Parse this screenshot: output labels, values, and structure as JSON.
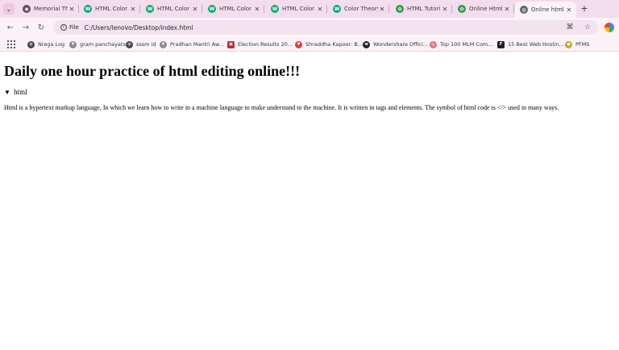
{
  "tabs": [
    {
      "title": "Memorial The",
      "icon": "memorial-favicon",
      "color": "#5b4f58"
    },
    {
      "title": "HTML Color",
      "icon": "w3schools-favicon",
      "color": "#04aa6d"
    },
    {
      "title": "HTML Color",
      "icon": "w3schools-favicon",
      "color": "#04aa6d"
    },
    {
      "title": "HTML Color",
      "icon": "w3schools-favicon",
      "color": "#04aa6d"
    },
    {
      "title": "HTML Color",
      "icon": "w3schools-favicon",
      "color": "#04aa6d"
    },
    {
      "title": "Color Theory",
      "icon": "w3schools-favicon",
      "color": "#04aa6d"
    },
    {
      "title": "HTML Tutori",
      "icon": "green-leaf-favicon",
      "color": "#2e9e4f"
    },
    {
      "title": "Online Html",
      "icon": "green-leaf-favicon",
      "color": "#2e9e4f"
    },
    {
      "title": "Online html",
      "icon": "globe-favicon",
      "color": "#5f6368"
    }
  ],
  "toolbar": {
    "back_icon": "←",
    "forward_icon": "→",
    "reload_icon": "↻",
    "chip_label": "File",
    "url": "C:/Users/lenovo/Desktop/index.html",
    "translate_icon": "⌘",
    "star_icon": "☆"
  },
  "bookmarks": [
    {
      "label": "Nrega Log",
      "icon": "globe-icon",
      "color": "#444444"
    },
    {
      "label": "gram panchayats",
      "icon": "emblem-icon",
      "color": "#8a8a8a"
    },
    {
      "label": "sssm id",
      "icon": "globe-icon",
      "color": "#444444"
    },
    {
      "label": "Pradhan Mantri Aw...",
      "icon": "emblem-icon",
      "color": "#8a8a8a"
    },
    {
      "label": "Election Results 20...",
      "icon": "election-icon",
      "color": "#c62828"
    },
    {
      "label": "Shraddha Kapoor: B...",
      "icon": "vivaldi-icon",
      "color": "#e53935"
    },
    {
      "label": "Wondershare Offici...",
      "icon": "wondershare-icon",
      "color": "#222222"
    },
    {
      "label": "Top 100 MLM Com...",
      "icon": "mlm-icon",
      "color": "#e57373"
    },
    {
      "label": "15 Best Web Hostin...",
      "icon": "f-icon",
      "color": "#222222"
    },
    {
      "label": "PFMS",
      "icon": "pfms-icon",
      "color": "#c9a227"
    }
  ],
  "page": {
    "heading": "Daily one hour practice of html editing online!!!",
    "summary": "html",
    "paragraph": "Html is a hypertext markup language, In which we learn how to write in a machine language to make understand to the machine. It is written in tags and elements. The symbol of html code is </> used in many ways."
  }
}
